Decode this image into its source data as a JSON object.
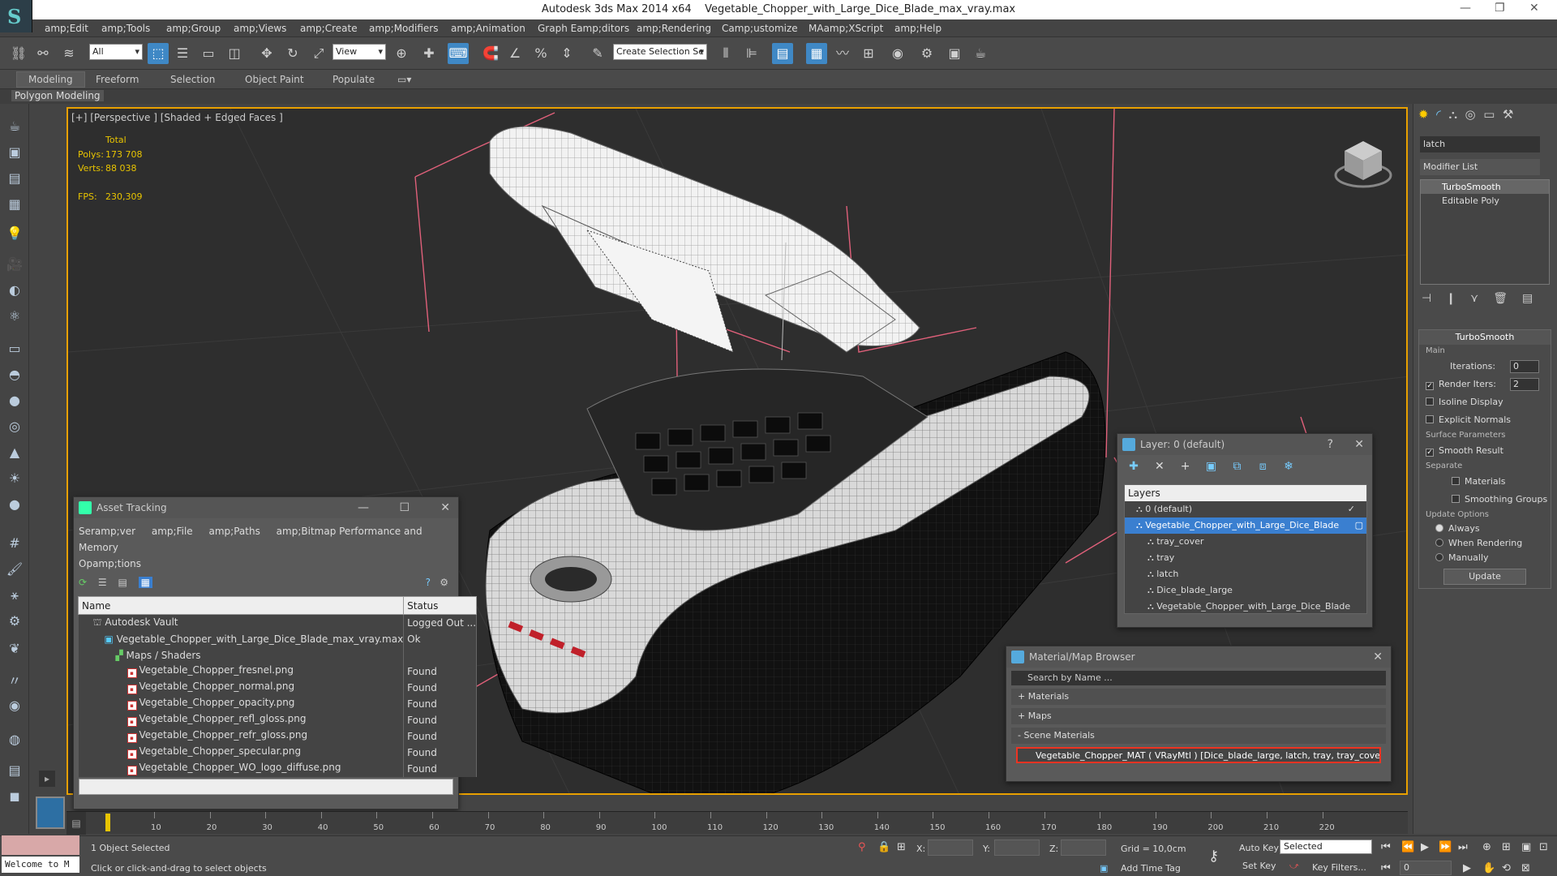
{
  "title_bar": {
    "app": "Autodesk 3ds Max  2014 x64",
    "file": "Vegetable_Chopper_with_Large_Dice_Blade_max_vray.max"
  },
  "menu": [
    "amp;Edit",
    "amp;Tools",
    "amp;Group",
    "amp;Views",
    "amp;Create",
    "amp;Modifiers",
    "amp;Animation",
    "Graph Eamp;ditors",
    "amp;Rendering",
    "Camp;ustomize",
    "MAamp;XScript",
    "amp;Help"
  ],
  "toolbar": {
    "selection_filter": "All",
    "ref_coord": "View",
    "named_selection": "Create Selection Se"
  },
  "ribbon_tabs": [
    "Modeling",
    "Freeform",
    "Selection",
    "Object Paint",
    "Populate"
  ],
  "ribbon_sub": "Polygon Modeling",
  "viewport": {
    "label": "[+] [Perspective ] [Shaded + Edged Faces ]",
    "stats_header": "Total",
    "polys_label": "Polys:",
    "polys": "173 708",
    "verts_label": "Verts:",
    "verts": "88 038",
    "fps_label": "FPS:",
    "fps": "230,309"
  },
  "asset_tracking": {
    "title": "Asset Tracking",
    "menu": [
      "Seramp;ver",
      "amp;File",
      "amp;Paths",
      "amp;Bitmap Performance and Memory",
      "Opamp;tions"
    ],
    "col_name": "Name",
    "col_status": "Status",
    "rows": [
      {
        "name": "Autodesk Vault",
        "status": "Logged Out ...",
        "indent": 1,
        "icon": "vault"
      },
      {
        "name": "Vegetable_Chopper_with_Large_Dice_Blade_max_vray.max",
        "status": "Ok",
        "indent": 2,
        "icon": "max"
      },
      {
        "name": "Maps / Shaders",
        "status": "",
        "indent": 3,
        "icon": "maps"
      },
      {
        "name": "Vegetable_Chopper_fresnel.png",
        "status": "Found",
        "indent": 4,
        "icon": "png"
      },
      {
        "name": "Vegetable_Chopper_normal.png",
        "status": "Found",
        "indent": 4,
        "icon": "png"
      },
      {
        "name": "Vegetable_Chopper_opacity.png",
        "status": "Found",
        "indent": 4,
        "icon": "png"
      },
      {
        "name": "Vegetable_Chopper_refl_gloss.png",
        "status": "Found",
        "indent": 4,
        "icon": "png"
      },
      {
        "name": "Vegetable_Chopper_refr_gloss.png",
        "status": "Found",
        "indent": 4,
        "icon": "png"
      },
      {
        "name": "Vegetable_Chopper_specular.png",
        "status": "Found",
        "indent": 4,
        "icon": "png"
      },
      {
        "name": "Vegetable_Chopper_WO_logo_diffuse.png",
        "status": "Found",
        "indent": 4,
        "icon": "png"
      }
    ]
  },
  "layer_panel": {
    "title": "Layer: 0 (default)",
    "help": "?",
    "header": "Layers",
    "items": [
      {
        "name": "0 (default)",
        "indent": 1,
        "selected": false
      },
      {
        "name": "Vegetable_Chopper_with_Large_Dice_Blade",
        "indent": 1,
        "selected": true
      },
      {
        "name": "tray_cover",
        "indent": 2,
        "selected": false
      },
      {
        "name": "tray",
        "indent": 2,
        "selected": false
      },
      {
        "name": "latch",
        "indent": 2,
        "selected": false
      },
      {
        "name": "Dice_blade_large",
        "indent": 2,
        "selected": false
      },
      {
        "name": "Vegetable_Chopper_with_Large_Dice_Blade",
        "indent": 2,
        "selected": false
      }
    ]
  },
  "material_browser": {
    "title": "Material/Map Browser",
    "search": "Search by Name ...",
    "sections": [
      "+ Materials",
      "+ Maps",
      "- Scene Materials"
    ],
    "material": "Vegetable_Chopper_MAT ( VRayMtl ) [Dice_blade_large, latch, tray, tray_cover]"
  },
  "command_panel": {
    "object_name": "latch",
    "modifier_list": "Modifier List",
    "stack": [
      "TurboSmooth",
      "Editable Poly"
    ],
    "turbosmooth": {
      "title": "TurboSmooth",
      "main": "Main",
      "iterations_label": "Iterations:",
      "iterations": "0",
      "render_iters_label": "Render Iters:",
      "render_iters": "2",
      "isoline": "Isoline Display",
      "explicit": "Explicit Normals",
      "surface": "Surface Parameters",
      "smooth_result": "Smooth Result",
      "separate": "Separate",
      "materials": "Materials",
      "smoothing_groups": "Smoothing Groups",
      "update_options": "Update Options",
      "always": "Always",
      "when_rendering": "When Rendering",
      "manually": "Manually",
      "update_btn": "Update"
    }
  },
  "timeline": {
    "ticks": [
      "10",
      "20",
      "30",
      "40",
      "50",
      "60",
      "70",
      "80",
      "90",
      "100",
      "110",
      "120",
      "130",
      "140",
      "150",
      "160",
      "170",
      "180",
      "190",
      "200",
      "210",
      "220"
    ]
  },
  "status": {
    "selected": "1 Object Selected",
    "prompt": "Click or click-and-drag to select objects",
    "welcome": "Welcome to M",
    "x": "X:",
    "y": "Y:",
    "z": "Z:",
    "grid": "Grid = 10,0cm",
    "add_time_tag": "Add Time Tag",
    "auto_key": "Auto Key",
    "set_key": "Set Key",
    "selected_dd": "Selected",
    "key_filters": "Key Filters...",
    "frame": "0"
  }
}
